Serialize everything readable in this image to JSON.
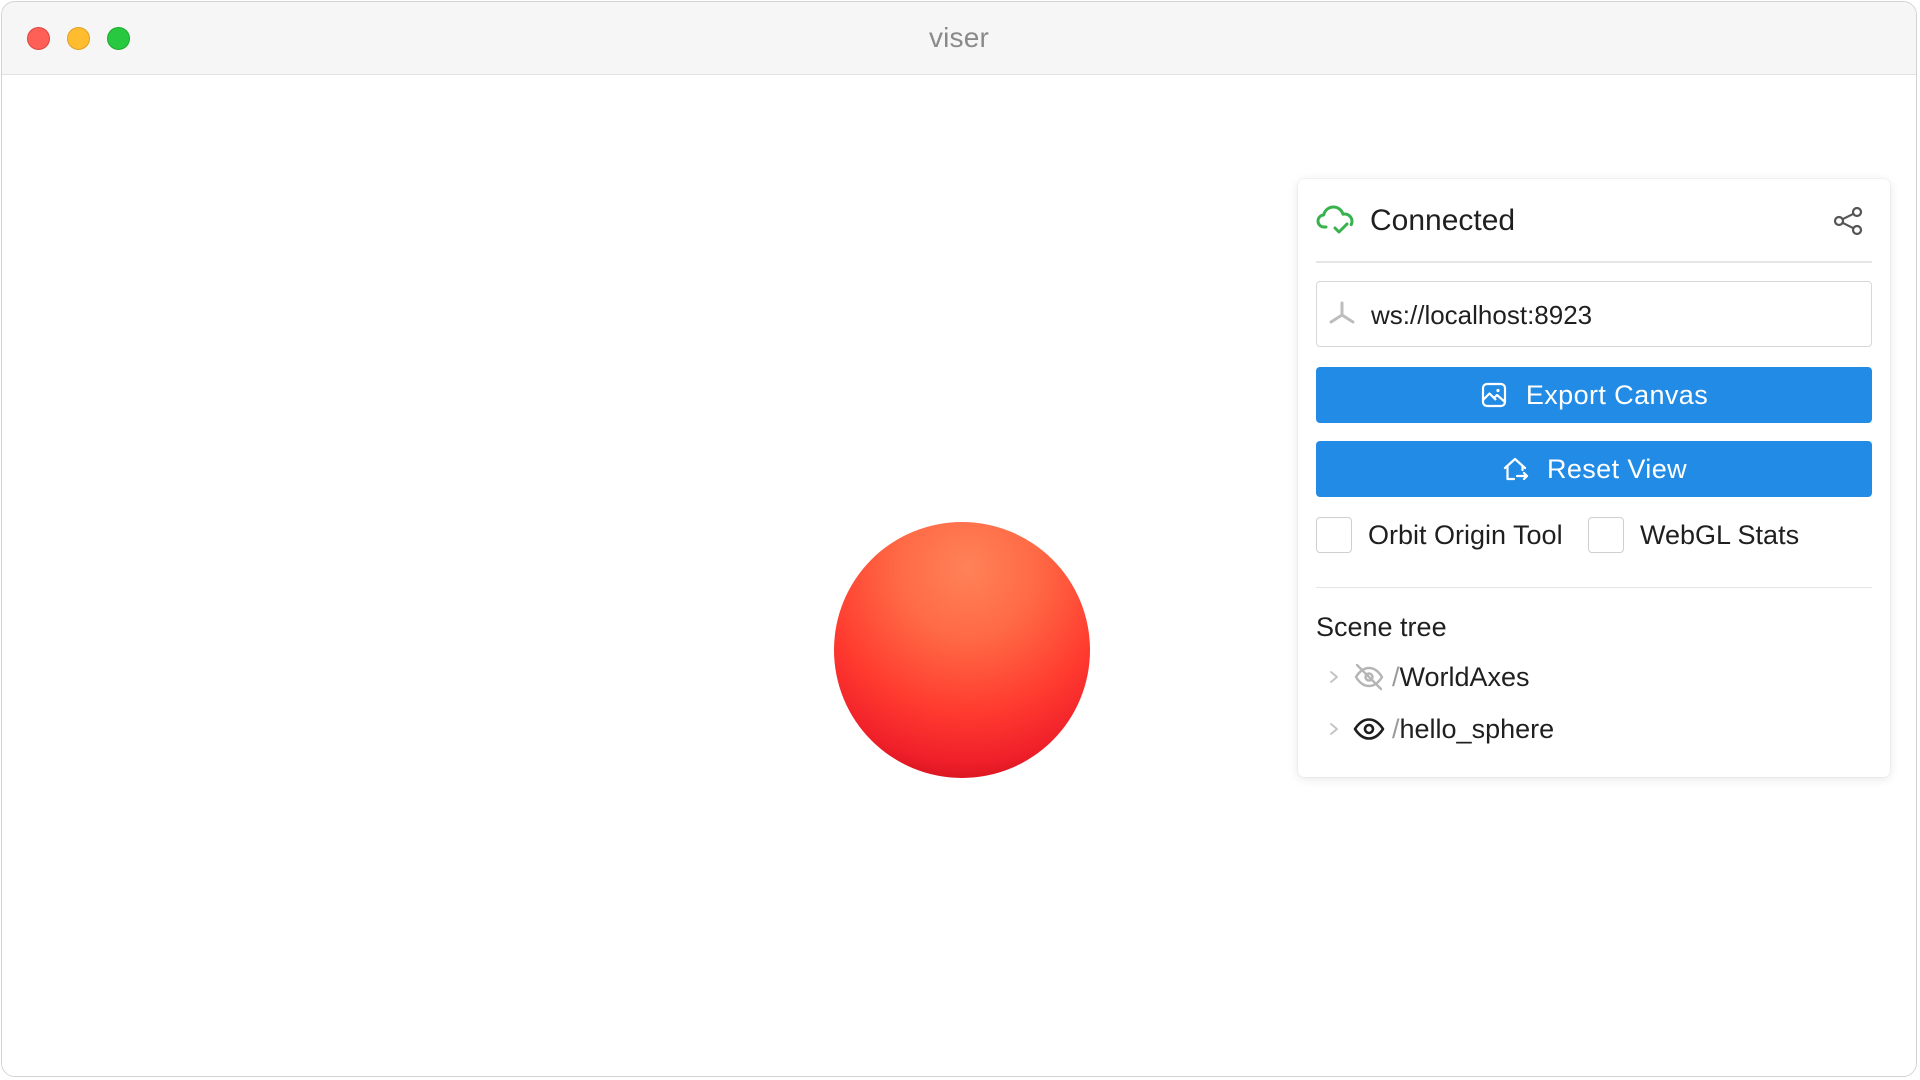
{
  "window": {
    "title": "viser"
  },
  "status": {
    "text": "Connected",
    "icon": "cloud-check-icon",
    "color": "#37b24d",
    "share_icon": "share-icon"
  },
  "server": {
    "value": "ws://localhost:8923",
    "icon": "viser-logo-icon"
  },
  "buttons": {
    "export": {
      "label": "Export Canvas",
      "icon": "photo-icon"
    },
    "reset": {
      "label": "Reset View",
      "icon": "home-move-icon"
    }
  },
  "toggles": [
    {
      "label": "Orbit Origin Tool",
      "checked": false
    },
    {
      "label": "WebGL Stats",
      "checked": false
    }
  ],
  "scene_tree": {
    "title": "Scene tree",
    "separator": "/",
    "nodes": [
      {
        "name": "WorldAxes",
        "visible": false,
        "icon": "eye-off-icon"
      },
      {
        "name": "hello_sphere",
        "visible": true,
        "icon": "eye-icon"
      }
    ]
  },
  "colors": {
    "accent": "#228be6",
    "sphere": "#ff3b2f",
    "connected": "#37b24d"
  }
}
